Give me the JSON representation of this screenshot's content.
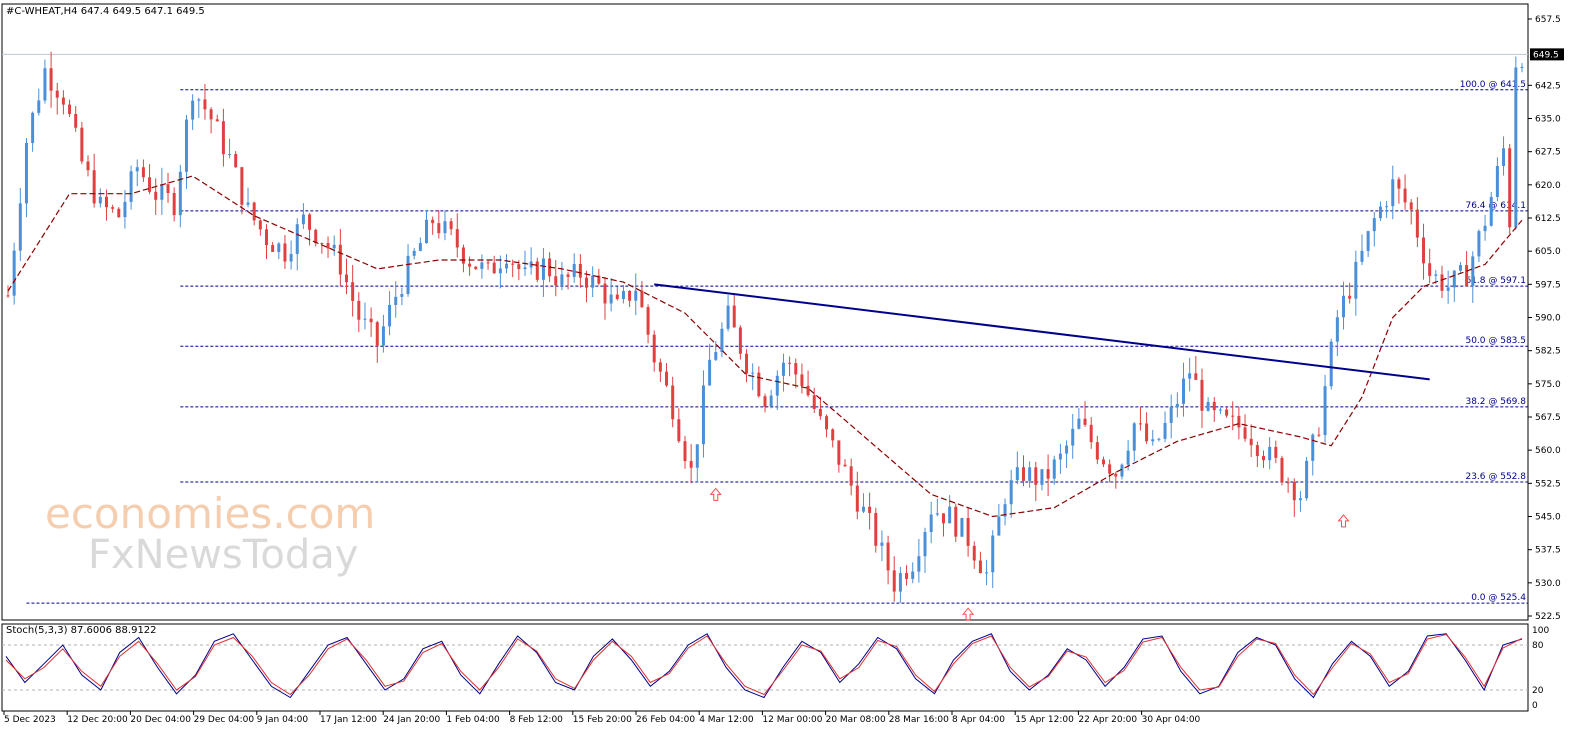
{
  "header": {
    "symbol_line": "#C-WHEAT,H4  647.4 649.5 647.1 649.5"
  },
  "watermark": {
    "line1": "economies.com",
    "line2": "FxNewsToday"
  },
  "colors": {
    "up_candle": "#4a90d9",
    "down_candle": "#e04040",
    "ma": "#8b0000",
    "trendline": "#00008b",
    "fib": "#00008b",
    "stoch_main": "#00008b",
    "stoch_signal": "#e03030",
    "arrow": "#ff4d4d"
  },
  "chart_data": [
    {
      "type": "candlestick",
      "symbol": "#C-WHEAT",
      "timeframe": "H4",
      "ylim": [
        522.5,
        657.5
      ],
      "y_ticks": [
        "657.5",
        "642.5",
        "635.0",
        "627.5",
        "620.0",
        "612.5",
        "605.0",
        "597.5",
        "590.0",
        "582.5",
        "575.0",
        "567.5",
        "560.0",
        "552.5",
        "545.0",
        "537.5",
        "530.0",
        "522.5"
      ],
      "current_price": "649.5",
      "x_ticks": [
        "5 Dec 2023",
        "12 Dec 20:00",
        "20 Dec 04:00",
        "29 Dec 04:00",
        "9 Jan 04:00",
        "17 Jan 12:00",
        "24 Jan 20:00",
        "1 Feb 04:00",
        "8 Feb 12:00",
        "15 Feb 20:00",
        "26 Feb 04:00",
        "4 Mar 12:00",
        "12 Mar 00:00",
        "20 Mar 08:00",
        "28 Mar 16:00",
        "8 Apr 04:00",
        "15 Apr 12:00",
        "22 Apr 20:00",
        "30 Apr 04:00"
      ],
      "price_path": [
        [
          0,
          595
        ],
        [
          3,
          630
        ],
        [
          6,
          646
        ],
        [
          9,
          640
        ],
        [
          12,
          625
        ],
        [
          15,
          615
        ],
        [
          18,
          613
        ],
        [
          21,
          624
        ],
        [
          24,
          618
        ],
        [
          27,
          616
        ],
        [
          30,
          642
        ],
        [
          33,
          635
        ],
        [
          36,
          626
        ],
        [
          39,
          614
        ],
        [
          42,
          608
        ],
        [
          45,
          605
        ],
        [
          48,
          612
        ],
        [
          51,
          608
        ],
        [
          54,
          602
        ],
        [
          57,
          590
        ],
        [
          60,
          584
        ],
        [
          63,
          595
        ],
        [
          66,
          604
        ],
        [
          69,
          612
        ],
        [
          72,
          608
        ],
        [
          75,
          603
        ],
        [
          78,
          600
        ],
        [
          81,
          605
        ],
        [
          84,
          599
        ],
        [
          87,
          602
        ],
        [
          90,
          598
        ],
        [
          93,
          600
        ],
        [
          96,
          597
        ],
        [
          99,
          592
        ],
        [
          102,
          597
        ],
        [
          105,
          581
        ],
        [
          108,
          570
        ],
        [
          111,
          555
        ],
        [
          114,
          580
        ],
        [
          117,
          590
        ],
        [
          120,
          580
        ],
        [
          123,
          572
        ],
        [
          126,
          580
        ],
        [
          129,
          576
        ],
        [
          132,
          566
        ],
        [
          135,
          558
        ],
        [
          138,
          549
        ],
        [
          141,
          540
        ],
        [
          144,
          530
        ],
        [
          147,
          535
        ],
        [
          150,
          547
        ],
        [
          153,
          545
        ],
        [
          156,
          540
        ],
        [
          159,
          532
        ],
        [
          162,
          550
        ],
        [
          165,
          555
        ],
        [
          168,
          553
        ],
        [
          171,
          558
        ],
        [
          174,
          566
        ],
        [
          177,
          560
        ],
        [
          180,
          555
        ],
        [
          183,
          566
        ],
        [
          186,
          560
        ],
        [
          189,
          568
        ],
        [
          192,
          578
        ],
        [
          195,
          568
        ],
        [
          198,
          566
        ],
        [
          201,
          565
        ],
        [
          204,
          560
        ],
        [
          207,
          555
        ],
        [
          210,
          550
        ],
        [
          213,
          566
        ],
        [
          216,
          590
        ],
        [
          219,
          600
        ],
        [
          222,
          612
        ],
        [
          225,
          620
        ],
        [
          228,
          614
        ],
        [
          231,
          600
        ],
        [
          234,
          597
        ],
        [
          237,
          600
        ],
        [
          240,
          612
        ],
        [
          243,
          628
        ],
        [
          244,
          612
        ],
        [
          245,
          648
        ],
        [
          246,
          649.5
        ]
      ],
      "moving_average": [
        [
          0,
          596
        ],
        [
          10,
          618
        ],
        [
          20,
          618
        ],
        [
          30,
          622
        ],
        [
          40,
          613
        ],
        [
          50,
          607
        ],
        [
          60,
          601
        ],
        [
          70,
          603
        ],
        [
          80,
          603
        ],
        [
          90,
          601
        ],
        [
          100,
          598
        ],
        [
          110,
          591
        ],
        [
          120,
          577
        ],
        [
          130,
          574
        ],
        [
          140,
          562
        ],
        [
          150,
          550
        ],
        [
          160,
          545
        ],
        [
          170,
          547
        ],
        [
          180,
          555
        ],
        [
          190,
          562
        ],
        [
          200,
          566
        ],
        [
          210,
          563
        ],
        [
          215,
          561
        ],
        [
          220,
          572
        ],
        [
          225,
          590
        ],
        [
          230,
          597
        ],
        [
          240,
          602
        ],
        [
          246,
          612
        ]
      ],
      "fibonacci_levels": [
        {
          "label": "100.0 @ 641.5",
          "price": 641.5
        },
        {
          "label": "76.4 @ 614.1",
          "price": 614.1
        },
        {
          "label": "61.8 @ 597.1",
          "price": 597.1
        },
        {
          "label": "50.0 @ 583.5",
          "price": 583.5
        },
        {
          "label": "38.2 @ 569.8",
          "price": 569.8
        },
        {
          "label": "23.6 @ 552.8",
          "price": 552.8
        },
        {
          "label": "0.0 @ 525.4",
          "price": 525.4
        }
      ],
      "trendline": {
        "from": [
          105,
          597.5
        ],
        "to": [
          231,
          576
        ]
      },
      "arrows": [
        {
          "x": 115,
          "price": 550
        },
        {
          "x": 156,
          "price": 522.9
        },
        {
          "x": 217,
          "price": 544
        }
      ]
    },
    {
      "type": "line",
      "indicator": "Stochastic",
      "label": "Stoch(5,3,3) 87.6006 88.9122",
      "ylim": [
        0,
        100
      ],
      "y_ticks": [
        "100",
        "80",
        "20",
        "0"
      ],
      "series": [
        {
          "values": [
            65,
            30,
            55,
            80,
            40,
            20,
            70,
            90,
            50,
            15,
            40,
            85,
            95,
            60,
            25,
            10,
            45,
            80,
            90,
            55,
            20,
            35,
            75,
            85,
            40,
            15,
            55,
            92,
            70,
            30,
            20,
            65,
            88,
            60,
            25,
            45,
            80,
            95,
            50,
            20,
            10,
            50,
            85,
            70,
            30,
            55,
            90,
            75,
            35,
            15,
            60,
            85,
            95,
            45,
            20,
            40,
            75,
            60,
            25,
            50,
            88,
            92,
            45,
            15,
            25,
            70,
            90,
            80,
            35,
            10,
            55,
            85,
            65,
            25,
            45,
            92,
            95,
            60,
            20,
            80,
            88
          ]
        },
        {
          "values": [
            60,
            35,
            50,
            75,
            45,
            25,
            65,
            85,
            55,
            20,
            38,
            80,
            90,
            65,
            30,
            14,
            40,
            75,
            88,
            60,
            25,
            32,
            70,
            82,
            45,
            20,
            50,
            88,
            72,
            35,
            22,
            60,
            85,
            65,
            30,
            42,
            76,
            92,
            55,
            25,
            14,
            46,
            80,
            72,
            35,
            50,
            86,
            78,
            40,
            18,
            55,
            82,
            92,
            50,
            24,
            38,
            72,
            64,
            30,
            46,
            84,
            90,
            50,
            20,
            24,
            65,
            88,
            82,
            40,
            14,
            50,
            82,
            68,
            30,
            42,
            88,
            94,
            64,
            25,
            76,
            89
          ]
        }
      ]
    }
  ]
}
